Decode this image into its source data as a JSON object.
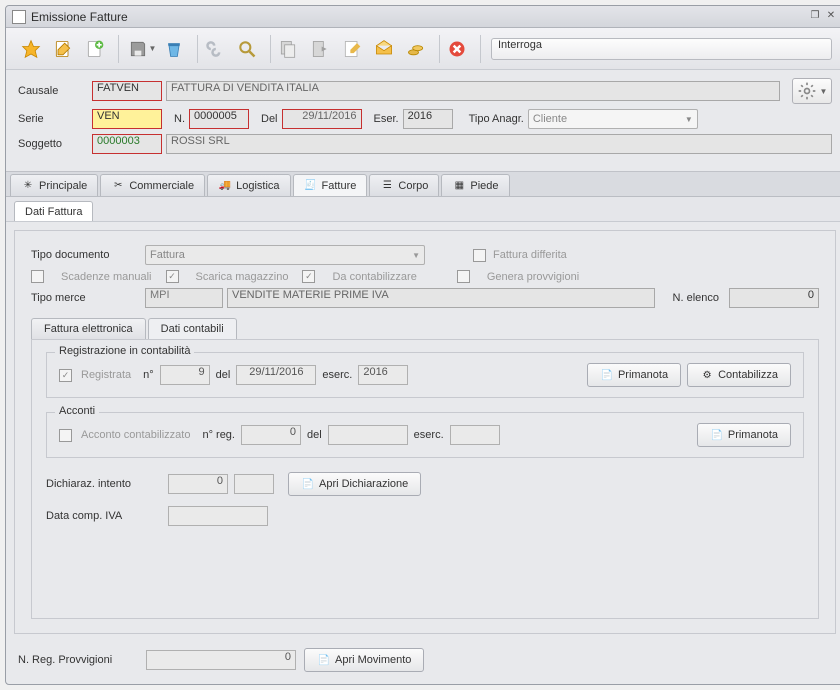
{
  "window": {
    "title": "Emissione Fatture"
  },
  "toolbar": {
    "search_label": "Interroga"
  },
  "header": {
    "causale_label": "Causale",
    "causale_value": "FATVEN",
    "causale_desc": "FATTURA DI VENDITA ITALIA",
    "serie_label": "Serie",
    "serie_value": "VEN",
    "n_label": "N.",
    "n_value": "0000005",
    "del_label": "Del",
    "del_value": "29/11/2016",
    "eser_label": "Eser.",
    "eser_value": "2016",
    "tipoanagr_label": "Tipo Anagr.",
    "tipoanagr_value": "Cliente",
    "soggetto_label": "Soggetto",
    "soggetto_value": "0000003",
    "soggetto_desc": "ROSSI SRL"
  },
  "maintabs": {
    "principale": "Principale",
    "commerciale": "Commerciale",
    "logistica": "Logistica",
    "fatture": "Fatture",
    "corpo": "Corpo",
    "piede": "Piede"
  },
  "subtab": {
    "dati_fattura": "Dati Fattura"
  },
  "fattura": {
    "tipodoc_label": "Tipo documento",
    "tipodoc_value": "Fattura",
    "fattura_differita": "Fattura differita",
    "scadenze_manuali": "Scadenze manuali",
    "scarica_magazzino": "Scarica magazzino",
    "da_contabilizzare": "Da contabilizzare",
    "genera_provvigioni": "Genera provvigioni",
    "tipo_merce_label": "Tipo merce",
    "tipo_merce_value": "MPI",
    "tipo_merce_desc": "VENDITE MATERIE PRIME IVA",
    "n_elenco_label": "N. elenco",
    "n_elenco_value": "0"
  },
  "innertabs": {
    "fattura_el": "Fattura elettronica",
    "dati_contabili": "Dati contabili"
  },
  "reg": {
    "legend": "Registrazione in contabilità",
    "registrata": "Registrata",
    "n_label": "n°",
    "n_value": "9",
    "del_label": "del",
    "del_value": "29/11/2016",
    "eserc_label": "eserc.",
    "eserc_value": "2016",
    "primanota_btn": "Primanota",
    "contabilizza_btn": "Contabilizza"
  },
  "acconti": {
    "legend": "Acconti",
    "acconto_cont": "Acconto contabilizzato",
    "nreg_label": "n° reg.",
    "nreg_value": "0",
    "del_label": "del",
    "eserc_label": "eserc.",
    "primanota_btn": "Primanota"
  },
  "dichiar": {
    "label": "Dichiaraz. intento",
    "value": "0",
    "btn": "Apri Dichiarazione"
  },
  "datacomp": {
    "label": "Data comp. IVA"
  },
  "bottom": {
    "nreg_prov_label": "N. Reg. Provvigioni",
    "nreg_prov_value": "0",
    "apri_mov_btn": "Apri Movimento"
  }
}
